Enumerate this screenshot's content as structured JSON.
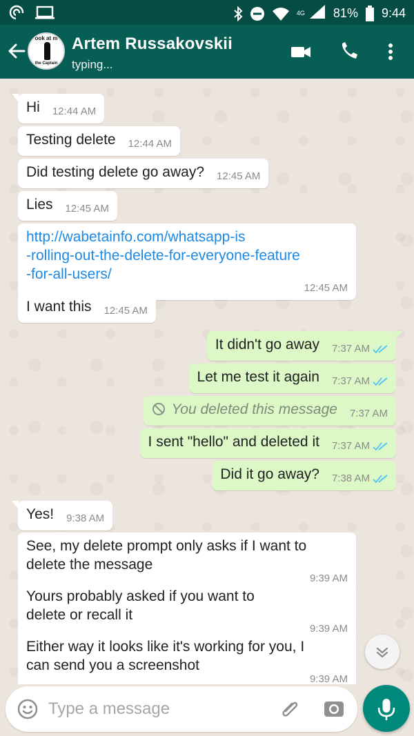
{
  "status_bar": {
    "network": "4G",
    "battery": "81%",
    "time": "9:44"
  },
  "header": {
    "contact_name": "Artem Russakovskii",
    "status": "typing...",
    "avatar_text_top": "ook at m",
    "avatar_text_bottom": "the Captain"
  },
  "messages": [
    {
      "dir": "in",
      "text": "Hi",
      "time": "12:44 AM"
    },
    {
      "dir": "in",
      "text": "Testing delete",
      "time": "12:44 AM"
    },
    {
      "dir": "in",
      "text": "Did testing delete go away?",
      "time": "12:45 AM"
    },
    {
      "dir": "in",
      "text": "Lies",
      "time": "12:45 AM"
    },
    {
      "dir": "in",
      "link_lines": [
        "http://wabetainfo.com/whatsapp-is",
        "-rolling-out-the-delete-for-everyone-feature",
        "-for-all-users/"
      ],
      "time": "12:45 AM"
    },
    {
      "dir": "in",
      "text": "I want this",
      "time": "12:45 AM"
    },
    {
      "dir": "out",
      "text": "It didn't go away",
      "time": "7:37 AM"
    },
    {
      "dir": "out",
      "text": "Let me test it again",
      "time": "7:37 AM"
    },
    {
      "dir": "out",
      "text": "You deleted this message",
      "time": "7:37 AM",
      "deleted": true
    },
    {
      "dir": "out",
      "text": "I sent \"hello\" and deleted it",
      "time": "7:37 AM"
    },
    {
      "dir": "out",
      "text": "Did it go away?",
      "time": "7:38 AM"
    },
    {
      "dir": "in",
      "text": "Yes!",
      "time": "9:38 AM"
    },
    {
      "dir": "in",
      "lines": [
        "See, my delete prompt only asks if I want to",
        "delete the message"
      ],
      "time": "9:39 AM"
    },
    {
      "dir": "in",
      "lines": [
        "Yours probably asked if you want to",
        "delete or recall it"
      ],
      "time": "9:39 AM"
    },
    {
      "dir": "in",
      "lines": [
        "Either way it looks like it's working for you, I",
        "can send you a screenshot"
      ],
      "time": "9:39 AM"
    }
  ],
  "composer": {
    "placeholder": "Type a message"
  },
  "colors": {
    "header": "#075e54",
    "status_bar": "#054d44",
    "outgoing_bubble": "#dcf8c6",
    "incoming_bubble": "#ffffff",
    "accent": "#00897b",
    "read_ticks": "#4fc3f7"
  },
  "icons": {
    "back": "arrow-left-icon",
    "video": "video-camera-icon",
    "call": "phone-icon",
    "menu": "more-vert-icon",
    "emoji": "emoji-icon",
    "attach": "paperclip-icon",
    "camera": "camera-icon",
    "mic": "microphone-icon",
    "scroll": "double-chevron-down-icon"
  }
}
